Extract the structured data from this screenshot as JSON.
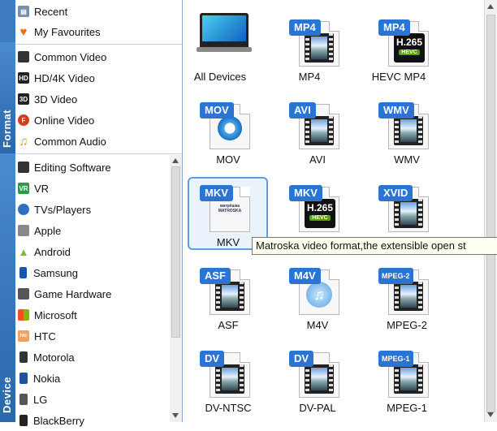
{
  "sidebar": {
    "format_label": "Format",
    "device_label": "Device",
    "top_items": [
      {
        "label": "Recent",
        "icon": "recent-icon"
      },
      {
        "label": "My Favourites",
        "icon": "heart-icon"
      }
    ],
    "format_items": [
      {
        "label": "Common Video",
        "icon": "film-icon"
      },
      {
        "label": "HD/4K Video",
        "icon": "hd-icon"
      },
      {
        "label": "3D Video",
        "icon": "3d-icon"
      },
      {
        "label": "Online Video",
        "icon": "online-icon"
      },
      {
        "label": "Common Audio",
        "icon": "music-note-icon"
      }
    ],
    "device_items": [
      {
        "label": "Editing Software",
        "icon": "film-icon"
      },
      {
        "label": "VR",
        "icon": "vr-icon"
      },
      {
        "label": "TVs/Players",
        "icon": "tv-icon"
      },
      {
        "label": "Apple",
        "icon": "apple-icon"
      },
      {
        "label": "Android",
        "icon": "android-icon"
      },
      {
        "label": "Samsung",
        "icon": "phone-icon"
      },
      {
        "label": "Game Hardware",
        "icon": "gamepad-icon"
      },
      {
        "label": "Microsoft",
        "icon": "microsoft-icon"
      },
      {
        "label": "HTC",
        "icon": "htc-icon"
      },
      {
        "label": "Motorola",
        "icon": "motorola-icon"
      },
      {
        "label": "Nokia",
        "icon": "nokia-icon"
      },
      {
        "label": "LG",
        "icon": "lg-icon"
      },
      {
        "label": "BlackBerry",
        "icon": "blackberry-icon"
      }
    ]
  },
  "grid": {
    "tiles": [
      {
        "caption": "All Devices",
        "badge": "",
        "kind": "devices"
      },
      {
        "caption": "MP4",
        "badge": "MP4",
        "kind": "film"
      },
      {
        "caption": "HEVC MP4",
        "badge": "MP4",
        "kind": "hevc",
        "hevc_top": "H.265",
        "hevc_bottom": "HEVC"
      },
      {
        "caption": "MOV",
        "badge": "MOV",
        "kind": "quicktime"
      },
      {
        "caption": "AVI",
        "badge": "AVI",
        "kind": "film"
      },
      {
        "caption": "WMV",
        "badge": "WMV",
        "kind": "film"
      },
      {
        "caption": "MKV",
        "badge": "MKV",
        "kind": "matroska",
        "logo_text": "матрёшка MATROSKA"
      },
      {
        "caption": "",
        "badge": "MKV",
        "kind": "hevc",
        "hevc_top": "H.265",
        "hevc_bottom": "HEVC"
      },
      {
        "caption": "",
        "badge": "XVID",
        "kind": "film"
      },
      {
        "caption": "ASF",
        "badge": "ASF",
        "kind": "film"
      },
      {
        "caption": "M4V",
        "badge": "M4V",
        "kind": "itunes"
      },
      {
        "caption": "MPEG-2",
        "badge": "MPEG-2",
        "kind": "film",
        "small": true
      },
      {
        "caption": "DV-NTSC",
        "badge": "DV",
        "kind": "film"
      },
      {
        "caption": "DV-PAL",
        "badge": "DV",
        "kind": "film"
      },
      {
        "caption": "MPEG-1",
        "badge": "MPEG-1",
        "kind": "film",
        "small": true
      }
    ],
    "selected_caption": "MKV"
  },
  "tooltip": {
    "text": "Matroska video format,the extensible open st"
  },
  "colors": {
    "accent": "#2b74d1",
    "strip": "#2f6fb5",
    "selection": "#5e9edc"
  }
}
